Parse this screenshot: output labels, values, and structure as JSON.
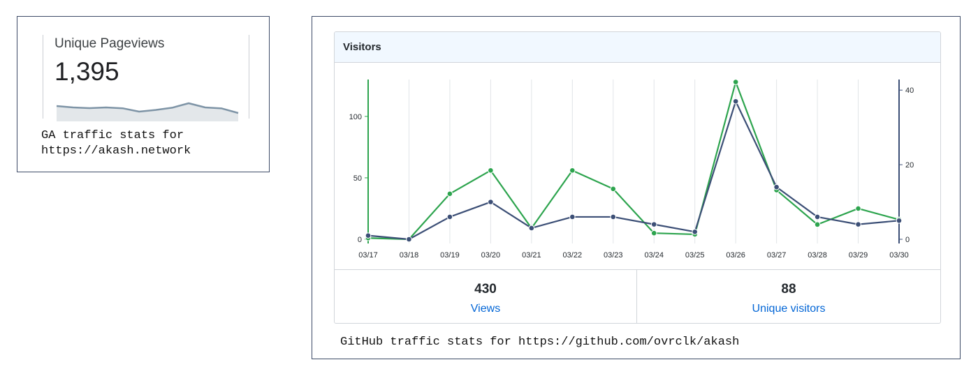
{
  "ga": {
    "label": "Unique Pageviews",
    "value": "1,395",
    "sparkline": [
      11,
      10,
      9.5,
      10,
      9.4,
      7,
      8.2,
      9.8,
      13,
      10,
      9.3,
      6
    ],
    "caption_line1": "GA traffic stats for",
    "caption_line2": "https://akash.network"
  },
  "github": {
    "title": "Visitors",
    "views_total": "430",
    "views_label": "Views",
    "uniques_total": "88",
    "uniques_label": "Unique visitors",
    "caption": "GitHub traffic stats for https://github.com/ovrclk/akash"
  },
  "chart_data": {
    "type": "line",
    "x": [
      "03/17",
      "03/18",
      "03/19",
      "03/20",
      "03/21",
      "03/22",
      "03/23",
      "03/24",
      "03/25",
      "03/26",
      "03/27",
      "03/28",
      "03/29",
      "03/30"
    ],
    "series": [
      {
        "name": "Views",
        "axis": "left",
        "color": "#2da44e",
        "values": [
          1,
          0,
          37,
          56,
          9,
          56,
          41,
          5,
          4,
          128,
          40,
          12,
          25,
          16
        ]
      },
      {
        "name": "Unique visitors",
        "axis": "right",
        "color": "#3c4f76",
        "values": [
          1,
          0,
          6,
          10,
          3,
          6,
          6,
          4,
          2,
          37,
          14,
          6,
          4,
          5
        ]
      }
    ],
    "left_axis": {
      "ticks": [
        0,
        50,
        100
      ],
      "ylim": [
        0,
        130
      ]
    },
    "right_axis": {
      "ticks": [
        0,
        20,
        40
      ],
      "ylim": [
        0,
        40.6
      ]
    },
    "grid": "vertical"
  }
}
